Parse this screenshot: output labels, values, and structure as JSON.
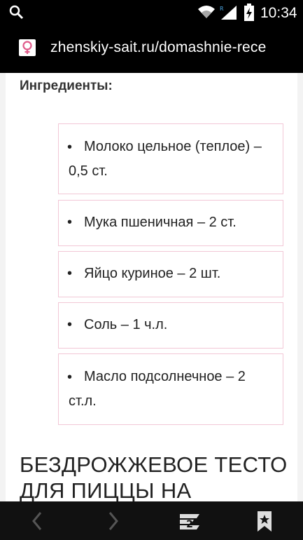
{
  "status_bar": {
    "time": "10:34",
    "icons": [
      "search-icon",
      "wifi-icon",
      "signal-icon",
      "battery-charging-icon"
    ]
  },
  "url_bar": {
    "url": "zhenskiy-sait.ru/domashnie-rece",
    "favicon": "site-favicon"
  },
  "content": {
    "ingredients_heading": "Ингредиенты:",
    "ingredients": [
      "Молоко цельное (теплое) – 0,5 ст.",
      "Мука пшеничная – 2 ст.",
      "Яйцо куриное – 2 шт.",
      "Соль – 1 ч.л.",
      "Масло подсолнечное – 2 ст.л."
    ],
    "section_title": "БЕЗДРОЖЖЕВОЕ ТЕСТО ДЛЯ ПИЦЦЫ НА"
  },
  "bottom_nav": {
    "tab_count": "2",
    "icons": [
      "back-icon",
      "forward-icon",
      "tabs-icon",
      "bookmark-icon"
    ]
  },
  "colors": {
    "accent_border": "#f2c7d6",
    "favicon_pink": "#e05a8a"
  }
}
